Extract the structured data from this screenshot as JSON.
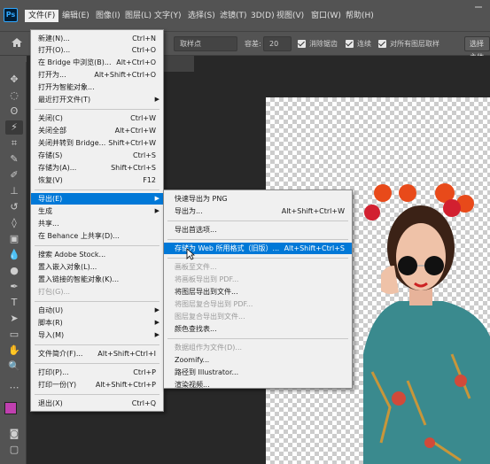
{
  "menubar": {
    "logo": "Ps",
    "items": [
      "文件(F)",
      "编辑(E)",
      "图像(I)",
      "图层(L)",
      "文字(Y)",
      "选择(S)",
      "滤镜(T)",
      "3D(D)",
      "视图(V)",
      "窗口(W)",
      "帮助(H)"
    ]
  },
  "options": {
    "sample_select": "取样点",
    "tolerance_label": "容差:",
    "tolerance_value": "20",
    "antialias_label": "消除锯齿",
    "contiguous_label": "连续",
    "all_layers_label": "对所有图层取样",
    "select_subject": "选择主体"
  },
  "document": {
    "tab_label": "/8) *"
  },
  "file_menu": [
    {
      "label": "新建(N)...",
      "shortcut": "Ctrl+N"
    },
    {
      "label": "打开(O)...",
      "shortcut": "Ctrl+O"
    },
    {
      "label": "在 Bridge 中浏览(B)...",
      "shortcut": "Alt+Ctrl+O"
    },
    {
      "label": "打开为...",
      "shortcut": "Alt+Shift+Ctrl+O"
    },
    {
      "label": "打开为智能对象...",
      "shortcut": ""
    },
    {
      "label": "最近打开文件(T)",
      "shortcut": "",
      "submenu": true
    },
    {
      "label": "关闭(C)",
      "shortcut": "Ctrl+W"
    },
    {
      "label": "关闭全部",
      "shortcut": "Alt+Ctrl+W"
    },
    {
      "label": "关闭并转到 Bridge...",
      "shortcut": "Shift+Ctrl+W"
    },
    {
      "label": "存储(S)",
      "shortcut": "Ctrl+S"
    },
    {
      "label": "存储为(A)...",
      "shortcut": "Shift+Ctrl+S"
    },
    {
      "label": "恢复(V)",
      "shortcut": "F12"
    },
    {
      "label": "导出(E)",
      "shortcut": "",
      "submenu": true,
      "highlight": true
    },
    {
      "label": "生成",
      "shortcut": "",
      "submenu": true
    },
    {
      "label": "共享...",
      "shortcut": ""
    },
    {
      "label": "在 Behance 上共享(D)...",
      "shortcut": ""
    },
    {
      "label": "搜索 Adobe Stock...",
      "shortcut": ""
    },
    {
      "label": "置入嵌入对象(L)...",
      "shortcut": ""
    },
    {
      "label": "置入链接的智能对象(K)...",
      "shortcut": ""
    },
    {
      "label": "打包(G)...",
      "shortcut": "",
      "disabled": true
    },
    {
      "label": "自动(U)",
      "shortcut": "",
      "submenu": true
    },
    {
      "label": "脚本(R)",
      "shortcut": "",
      "submenu": true
    },
    {
      "label": "导入(M)",
      "shortcut": "",
      "submenu": true
    },
    {
      "label": "文件简介(F)...",
      "shortcut": "Alt+Shift+Ctrl+I"
    },
    {
      "label": "打印(P)...",
      "shortcut": "Ctrl+P"
    },
    {
      "label": "打印一份(Y)",
      "shortcut": "Alt+Shift+Ctrl+P"
    },
    {
      "label": "退出(X)",
      "shortcut": "Ctrl+Q"
    }
  ],
  "export_menu": [
    {
      "label": "快速导出为 PNG",
      "shortcut": ""
    },
    {
      "label": "导出为...",
      "shortcut": "Alt+Shift+Ctrl+W"
    },
    {
      "label": "导出首选项...",
      "shortcut": ""
    },
    {
      "label": "存储为 Web 所用格式（旧版）...",
      "shortcut": "Alt+Shift+Ctrl+S",
      "highlight": true
    },
    {
      "label": "画板至文件...",
      "shortcut": "",
      "disabled": true
    },
    {
      "label": "将画板导出到 PDF...",
      "shortcut": "",
      "disabled": true
    },
    {
      "label": "将图层导出到文件...",
      "shortcut": ""
    },
    {
      "label": "将图层复合导出到 PDF...",
      "shortcut": "",
      "disabled": true
    },
    {
      "label": "图层复合导出到文件...",
      "shortcut": "",
      "disabled": true
    },
    {
      "label": "颜色查找表...",
      "shortcut": ""
    },
    {
      "label": "数据组作为文件(D)...",
      "shortcut": "",
      "disabled": true
    },
    {
      "label": "Zoomify...",
      "shortcut": ""
    },
    {
      "label": "路径到 Illustrator...",
      "shortcut": ""
    },
    {
      "label": "渲染视频...",
      "shortcut": ""
    }
  ],
  "colors": {
    "ui_bg": "#535353",
    "menu_bg": "#f0f0f0",
    "highlight": "#0078d7",
    "foreground_swatch": "#c040b0",
    "background_swatch": "#ffffff"
  }
}
